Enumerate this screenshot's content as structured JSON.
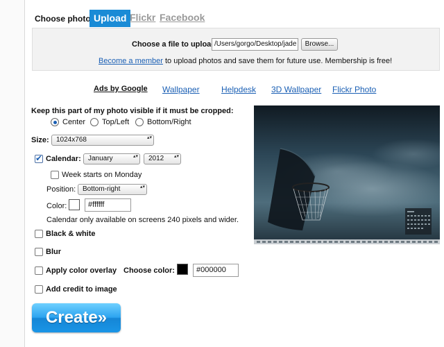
{
  "photo_source": {
    "label": "Choose photo:",
    "tabs": [
      "Upload",
      "Flickr",
      "Facebook"
    ]
  },
  "upload": {
    "file_label": "Choose a file to upload:",
    "file_value": "/Users/gorgo/Desktop/jade",
    "browse_label": "Browse...",
    "member_link": "Become a member",
    "member_text": " to upload photos and save them for future use. Membership is free!"
  },
  "ads": {
    "label": "Ads by Google",
    "links": [
      "Wallpaper",
      "Helpdesk",
      "3D Wallpaper",
      "Flickr Photo"
    ]
  },
  "crop": {
    "title": "Keep this part of my photo visible if it must be cropped:",
    "options": [
      "Center",
      "Top/Left",
      "Bottom/Right"
    ],
    "selected": "Center"
  },
  "size": {
    "label": "Size:",
    "value": "1024x768"
  },
  "calendar": {
    "label": "Calendar:",
    "checked": true,
    "month": "January",
    "year": "2012",
    "week_monday_label": "Week starts on Monday",
    "position_label": "Position:",
    "position_value": "Bottom-right",
    "color_label": "Color:",
    "color_value": "#ffffff",
    "note": "Calendar only available on screens 240 pixels and wider."
  },
  "effects": {
    "black_white": "Black & white",
    "blur": "Blur",
    "color_overlay": "Apply color overlay",
    "choose_color_label": "Choose color:",
    "overlay_color_value": "#000000",
    "add_credit": "Add credit to image"
  },
  "create_label": "Create»",
  "colors": {
    "accent": "#1a8bd6",
    "link": "#1a5fb4",
    "create_button": "#2da4f0",
    "calendar_swatch": "#ffffff",
    "overlay_swatch": "#000000"
  }
}
